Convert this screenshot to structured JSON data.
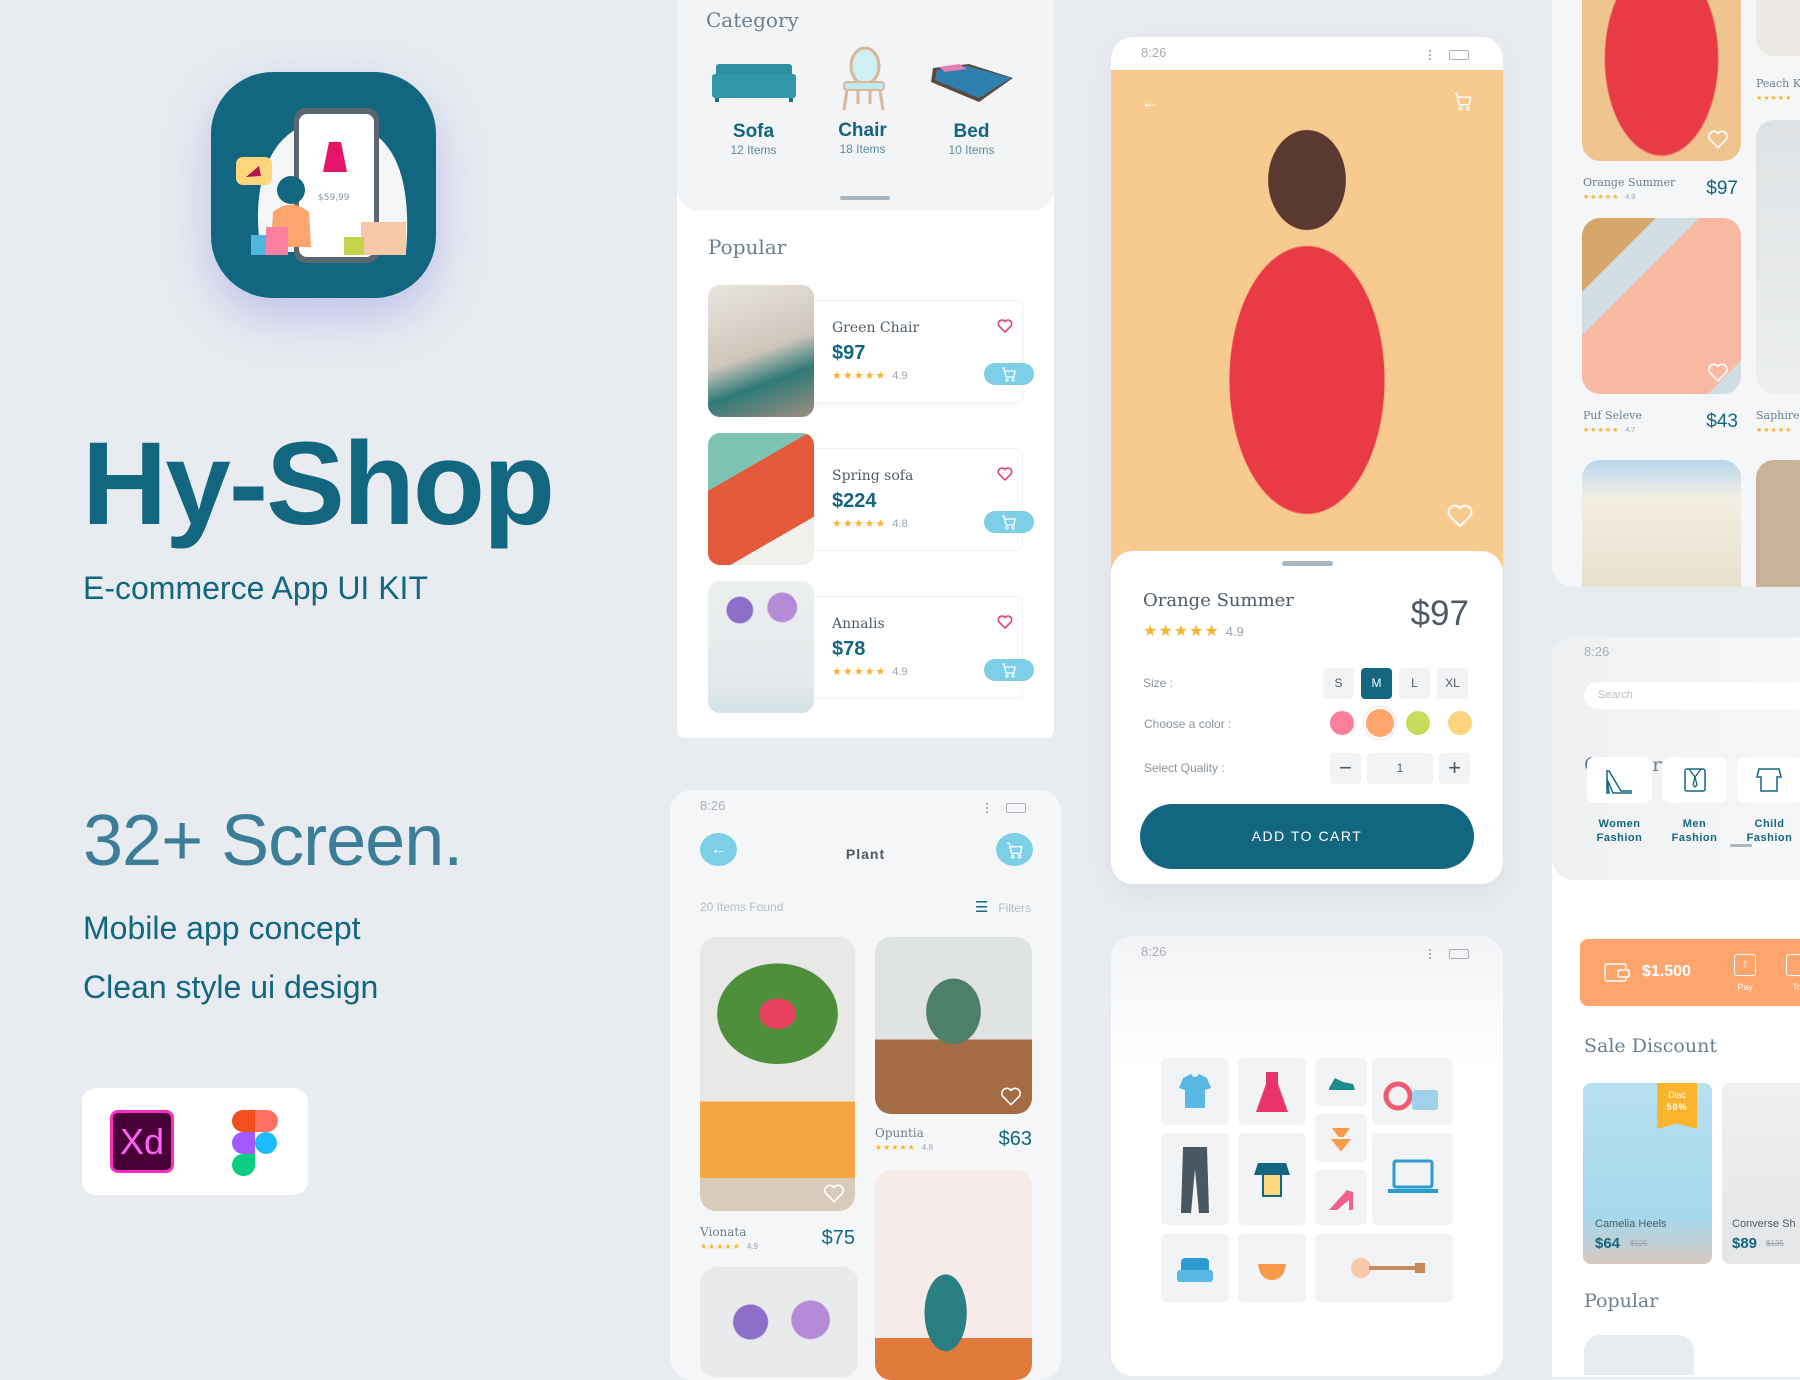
{
  "brand": {
    "title": "Hy-Shop",
    "subtitle": "E-commerce App UI KIT",
    "screens": "32+ Screen.",
    "taglines": [
      "Mobile app concept",
      "Clean style ui design"
    ],
    "icon_price": "$59,99",
    "tools": [
      {
        "label": "Xd",
        "icon": "adobe-xd-icon"
      },
      {
        "label": "",
        "icon": "figma-icon"
      }
    ]
  },
  "colors": {
    "primary": "#136680",
    "accent": "#7ccfe6",
    "star": "#f7b52c",
    "heart": "#e8346b",
    "orange": "#fda56d"
  },
  "furniture": {
    "category_title": "Category",
    "categories": [
      {
        "name": "Sofa",
        "count": "12 Items"
      },
      {
        "name": "Chair",
        "count": "18 Items"
      },
      {
        "name": "Bed",
        "count": "10 Items"
      }
    ],
    "popular_title": "Popular",
    "products": [
      {
        "name": "Green Chair",
        "price": "$97",
        "rating": "4.9"
      },
      {
        "name": "Spring sofa",
        "price": "$224",
        "rating": "4.8"
      },
      {
        "name": "Annalis",
        "price": "$78",
        "rating": "4.9"
      }
    ]
  },
  "detail": {
    "time": "8:26",
    "name": "Orange Summer",
    "rating": "4.9",
    "price": "$97",
    "size_label": "Size :",
    "sizes": [
      "S",
      "M",
      "L",
      "XL"
    ],
    "selected_size": "M",
    "color_label": "Choose a color :",
    "colors": [
      "#fe7f9c",
      "#ffa46c",
      "#c6dc5b",
      "#fed47f"
    ],
    "selected_color": "#ffa46c",
    "quantity_label": "Select Quality :",
    "quantity": "1",
    "add_to_cart": "ADD TO CART"
  },
  "icons_screen": {
    "time": "8:26"
  },
  "plant": {
    "time": "8:26",
    "title": "Plant",
    "found": "20 Items Found",
    "filters": "Filters",
    "items": [
      {
        "name": "Vionata",
        "price": "$75",
        "rating": "4.9"
      },
      {
        "name": "Opuntia",
        "price": "$63",
        "rating": "4.8"
      }
    ]
  },
  "fashion_grid": {
    "items": [
      {
        "name": "Orange Summer",
        "price": "$97",
        "rating": "4.9"
      },
      {
        "name": "Puf Seleve",
        "price": "$43",
        "rating": "4.7"
      },
      {
        "name": "Peach Ki"
      },
      {
        "name": "Saphire S"
      }
    ]
  },
  "home": {
    "time": "8:26",
    "search_placeholder": "Search",
    "category_title": "Category",
    "categories": [
      {
        "line1": "Women",
        "line2": "Fashion"
      },
      {
        "line1": "Men",
        "line2": "Fashion"
      },
      {
        "line1": "Child",
        "line2": "Fashion"
      }
    ],
    "balance": "$1.500",
    "pay": "Pay",
    "topup": "To",
    "sale_title": "Sale Discount",
    "discount_badge": [
      "Disc",
      "50%"
    ],
    "sale_items": [
      {
        "name": "Camelia Heels",
        "price": "$64",
        "old_price": "$125"
      },
      {
        "name": "Converse Sh",
        "price": "$89",
        "old_price": "$135"
      }
    ],
    "popular_title": "Popular"
  }
}
